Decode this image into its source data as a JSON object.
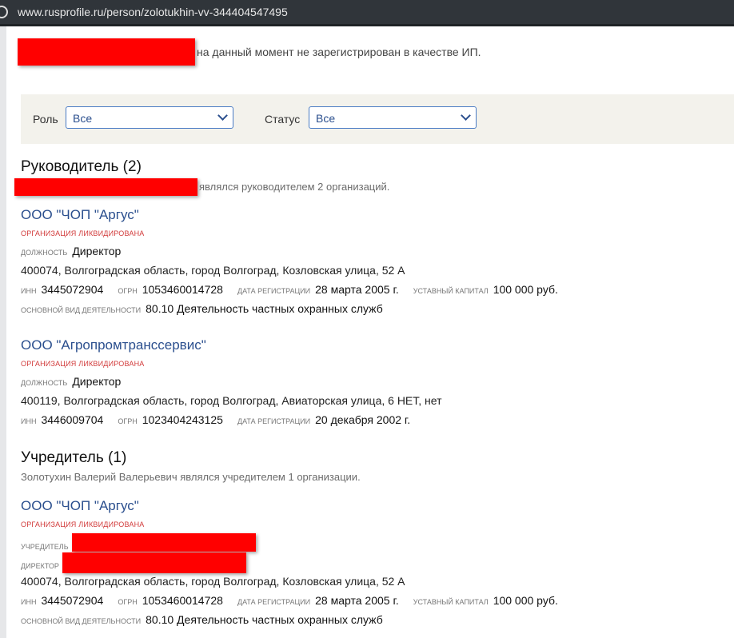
{
  "browser": {
    "url": "www.rusprofile.ru/person/zolotukhin-vv-344404547495"
  },
  "intro": "на данный момент не зарегистрирован в качестве ИП.",
  "filters": {
    "role_label": "Роль",
    "role_value": "Все",
    "status_label": "Статус",
    "status_value": "Все"
  },
  "labels": {
    "liquidated": "ОРГАНИЗАЦИЯ ЛИКВИДИРОВАНА",
    "position": "должность",
    "inn": "ИНН",
    "ogrn": "ОГРН",
    "reg_date": "дата регистрации",
    "capital": "уставный капитал",
    "activity": "основной вид деятельности",
    "founder": "учредитель",
    "director": "директор"
  },
  "head_section": {
    "title": "Руководитель (2)",
    "subtitle": "являлся руководителем 2 организаций.",
    "orgs": [
      {
        "name": "ООО \"ЧОП \"Аргус\"",
        "position": "Директор",
        "address": "400074, Волгоградская область, город Волгоград, Козловская улица, 52 А",
        "inn": "3445072904",
        "ogrn": "1053460014728",
        "reg_date": "28 марта 2005 г.",
        "capital": "100 000 руб.",
        "activity": "80.10 Деятельность частных охранных служб"
      },
      {
        "name": "ООО \"Агропромтранссервис\"",
        "position": "Директор",
        "address": "400119, Волгоградская область, город Волгоград, Авиаторская улица, 6 НЕТ, нет",
        "inn": "3446009704",
        "ogrn": "1023404243125",
        "reg_date": "20 декабря 2002 г."
      }
    ]
  },
  "founder_section": {
    "title": "Учредитель (1)",
    "subtitle": "Золотухин Валерий Валерьевич являлся учредителем 1 организации.",
    "org": {
      "name": "ООО \"ЧОП \"Аргус\"",
      "address": "400074, Волгоградская область, город Волгоград, Козловская улица, 52 А",
      "inn": "3445072904",
      "ogrn": "1053460014728",
      "reg_date": "28 марта 2005 г.",
      "capital": "100 000 руб.",
      "activity": "80.10 Деятельность частных охранных служб"
    }
  }
}
